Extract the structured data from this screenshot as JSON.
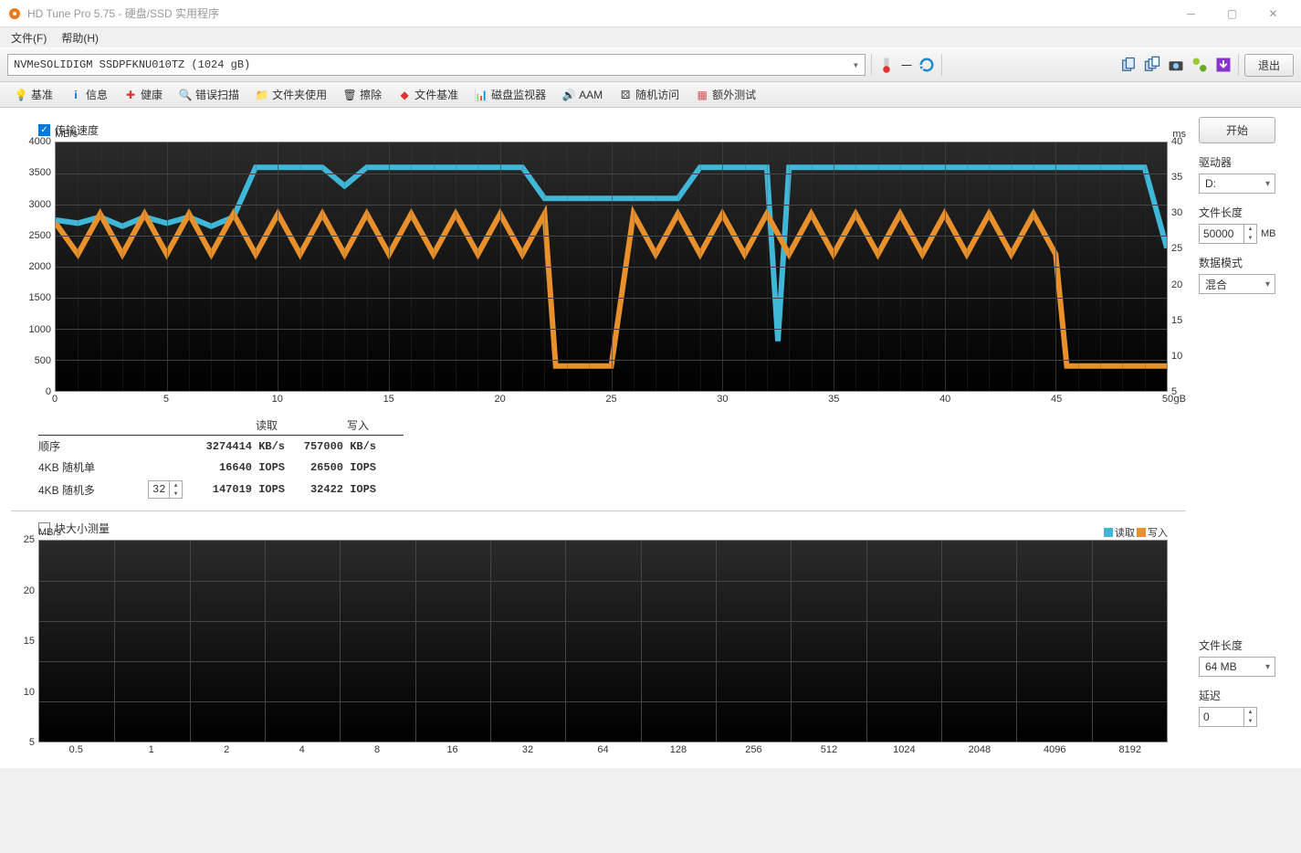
{
  "window": {
    "title": "HD Tune Pro 5.75 - 硬盘/SSD 实用程序"
  },
  "menu": {
    "file": "文件(F)",
    "help": "帮助(H)"
  },
  "toolbar": {
    "drive": "NVMeSOLIDIGM SSDPFKNU010TZ (1024 gB)",
    "exit": "退出"
  },
  "tabs": {
    "t1": "基准",
    "t2": "信息",
    "t3": "健康",
    "t4": "错误扫描",
    "t5": "文件夹使用",
    "t6": "擦除",
    "t7": "文件基准",
    "t8": "磁盘监视器",
    "t9": "AAM",
    "t10": "随机访问",
    "t11": "额外测试"
  },
  "chk_transfer": "传输速度",
  "chk_blocksize": "块大小测量",
  "axes": {
    "left_unit": "MB/s",
    "right_unit": "ms",
    "bottom_unit": "gB",
    "left": [
      "4000",
      "3500",
      "3000",
      "2500",
      "2000",
      "1500",
      "1000",
      "500",
      "0"
    ],
    "right": [
      "40",
      "35",
      "30",
      "25",
      "20",
      "15",
      "10",
      "5"
    ],
    "bottom": [
      "0",
      "5",
      "10",
      "15",
      "20",
      "25",
      "30",
      "35",
      "40",
      "45",
      "50"
    ],
    "left2_unit": "MB/s",
    "left2": [
      "25",
      "20",
      "15",
      "10",
      "5"
    ],
    "bottom2": [
      "0.5",
      "1",
      "2",
      "4",
      "8",
      "16",
      "32",
      "64",
      "128",
      "256",
      "512",
      "1024",
      "2048",
      "4096",
      "8192"
    ]
  },
  "legend2": {
    "read": "读取",
    "write": "写入"
  },
  "results": {
    "hdr_read": "读取",
    "hdr_write": "写入",
    "r1": {
      "label": "顺序",
      "read": "3274414 KB/s",
      "write": "757000 KB/s"
    },
    "r2": {
      "label": "4KB 随机单",
      "read": "16640 IOPS",
      "write": "26500 IOPS"
    },
    "r3": {
      "label": "4KB 随机多",
      "spin": "32",
      "read": "147019 IOPS",
      "write": "32422 IOPS"
    }
  },
  "side": {
    "start": "开始",
    "drive_lbl": "驱动器",
    "drive_val": "D:",
    "filelen_lbl": "文件长度",
    "filelen_val": "50000",
    "filelen_unit": "MB",
    "pattern_lbl": "数据模式",
    "pattern_val": "混合",
    "filelen2_lbl": "文件长度",
    "filelen2_val": "64 MB",
    "delay_lbl": "延迟",
    "delay_val": "0"
  },
  "chart_data": {
    "type": "line",
    "xlabel": "gB",
    "ylabel_left": "MB/s",
    "ylabel_right": "ms",
    "xlim": [
      0,
      50
    ],
    "ylim_left": [
      0,
      4000
    ],
    "ylim_right": [
      0,
      40
    ],
    "series": [
      {
        "name": "读取 (MB/s)",
        "color": "#3fb8d8",
        "x": [
          0,
          1,
          2,
          3,
          4,
          5,
          6,
          7,
          8,
          9,
          10,
          11,
          12,
          13,
          14,
          15,
          16,
          17,
          18,
          19,
          20,
          21,
          22,
          23,
          24,
          25,
          26,
          27,
          28,
          29,
          30,
          31,
          32,
          32.5,
          33,
          34,
          35,
          36,
          37,
          38,
          39,
          40,
          41,
          42,
          43,
          44,
          45,
          46,
          47,
          48,
          49,
          50
        ],
        "y": [
          2750,
          2700,
          2800,
          2650,
          2800,
          2700,
          2800,
          2650,
          2800,
          3600,
          3600,
          3600,
          3600,
          3300,
          3600,
          3600,
          3600,
          3600,
          3600,
          3600,
          3600,
          3600,
          3100,
          3100,
          3100,
          3100,
          3100,
          3100,
          3100,
          3600,
          3600,
          3600,
          3600,
          800,
          3600,
          3600,
          3600,
          3600,
          3600,
          3600,
          3600,
          3600,
          3600,
          3600,
          3600,
          3600,
          3600,
          3600,
          3600,
          3600,
          3600,
          2300
        ]
      },
      {
        "name": "写入 (MB/s)",
        "color": "#e8902c",
        "x": [
          0,
          1,
          2,
          3,
          4,
          5,
          6,
          7,
          8,
          9,
          10,
          11,
          12,
          13,
          14,
          15,
          16,
          17,
          18,
          19,
          20,
          21,
          22,
          22.5,
          23,
          24,
          25,
          26,
          27,
          28,
          29,
          30,
          31,
          32,
          33,
          34,
          35,
          36,
          37,
          38,
          39,
          40,
          41,
          42,
          43,
          44,
          45,
          45.5,
          46,
          47,
          48,
          49,
          50
        ],
        "y": [
          2700,
          2200,
          2850,
          2200,
          2850,
          2200,
          2850,
          2200,
          2850,
          2200,
          2850,
          2200,
          2850,
          2200,
          2850,
          2200,
          2850,
          2200,
          2850,
          2200,
          2850,
          2200,
          2850,
          400,
          400,
          400,
          400,
          2850,
          2200,
          2850,
          2200,
          2850,
          2200,
          2850,
          2200,
          2850,
          2200,
          2850,
          2200,
          2850,
          2200,
          2850,
          2200,
          2850,
          2200,
          2850,
          2200,
          400,
          400,
          400,
          400,
          400,
          400
        ]
      }
    ]
  }
}
